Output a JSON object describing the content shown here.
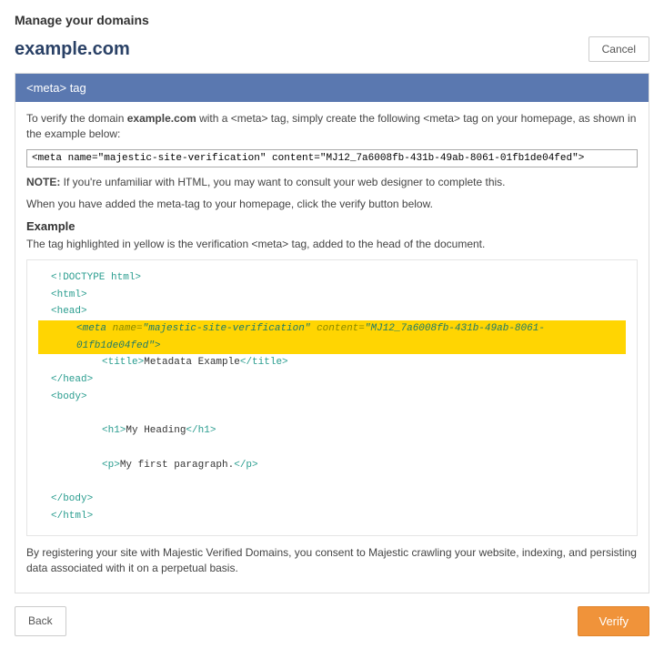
{
  "header": {
    "manage": "Manage your domains",
    "domain": "example.com",
    "cancel": "Cancel"
  },
  "panel": {
    "title": "<meta> tag",
    "intro_pre": "To verify the domain ",
    "intro_domain": "example.com",
    "intro_post": " with a <meta> tag, simply create the following <meta> tag on your homepage, as shown in the example below:",
    "meta_value": "<meta name=\"majestic-site-verification\" content=\"MJ12_7a6008fb-431b-49ab-8061-01fb1de04fed\">",
    "note_label": "NOTE:",
    "note_text": " If you're unfamiliar with HTML, you may want to consult your web designer to complete this.",
    "added_text": "When you have added the meta-tag to your homepage, click the verify button below.",
    "example_title": "Example",
    "example_desc": "The tag highlighted in yellow is the verification <meta> tag, added to the head of the document.",
    "consent": "By registering your site with Majestic Verified Domains, you consent to Majestic crawling your website, indexing, and persisting data associated with it on a perpetual basis."
  },
  "code": {
    "doctype": "<!DOCTYPE html>",
    "html_open": "<html>",
    "head_open": "<head>",
    "meta_open": "<meta ",
    "name_attr": "name=",
    "name_val": "\"majestic-site-verification\"",
    "content_attr": " content=",
    "content_val": "\"MJ12_7a6008fb-431b-49ab-8061-01fb1de04fed\"",
    "meta_close": ">",
    "title_open": "<title>",
    "title_text": "Metadata Example",
    "title_close": "</title>",
    "head_close": "</head>",
    "body_open": "<body>",
    "h1_open": "<h1>",
    "h1_text": "My Heading",
    "h1_close": "</h1>",
    "p_open": "<p>",
    "p_text": "My first paragraph.",
    "p_close": "</p>",
    "body_close": "</body>",
    "html_close": "</html>"
  },
  "footer": {
    "back": "Back",
    "verify": "Verify"
  }
}
